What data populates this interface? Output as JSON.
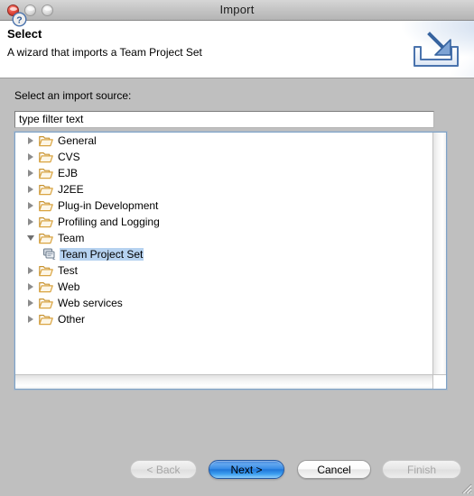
{
  "window": {
    "title": "Import",
    "traffic_lights": [
      {
        "name": "close-button",
        "color": "#e44b3e",
        "state": "active"
      },
      {
        "name": "minimize-button",
        "color": "#dcdcdc",
        "state": "disabled"
      },
      {
        "name": "zoom-button",
        "color": "#dcdcdc",
        "state": "disabled"
      }
    ]
  },
  "header": {
    "title": "Select",
    "subtitle": "A wizard that imports a Team Project Set",
    "icon": "import-wizard-icon"
  },
  "body": {
    "source_label": "Select an import source:",
    "filter": {
      "value": "type filter text",
      "placeholder": "type filter text"
    },
    "tree": [
      {
        "label": "General",
        "icon": "folder-icon",
        "expanded": false,
        "level": 0,
        "selected": false
      },
      {
        "label": "CVS",
        "icon": "folder-icon",
        "expanded": false,
        "level": 0,
        "selected": false
      },
      {
        "label": "EJB",
        "icon": "folder-icon",
        "expanded": false,
        "level": 0,
        "selected": false
      },
      {
        "label": "J2EE",
        "icon": "folder-icon",
        "expanded": false,
        "level": 0,
        "selected": false
      },
      {
        "label": "Plug-in Development",
        "icon": "folder-icon",
        "expanded": false,
        "level": 0,
        "selected": false
      },
      {
        "label": "Profiling and Logging",
        "icon": "folder-icon",
        "expanded": false,
        "level": 0,
        "selected": false
      },
      {
        "label": "Team",
        "icon": "folder-icon",
        "expanded": true,
        "level": 0,
        "selected": false
      },
      {
        "label": "Team Project Set",
        "icon": "project-set-icon",
        "expanded": null,
        "level": 1,
        "selected": true
      },
      {
        "label": "Test",
        "icon": "folder-icon",
        "expanded": false,
        "level": 0,
        "selected": false
      },
      {
        "label": "Web",
        "icon": "folder-icon",
        "expanded": false,
        "level": 0,
        "selected": false
      },
      {
        "label": "Web services",
        "icon": "folder-icon",
        "expanded": false,
        "level": 0,
        "selected": false
      },
      {
        "label": "Other",
        "icon": "folder-icon",
        "expanded": false,
        "level": 0,
        "selected": false
      }
    ],
    "scrollbars": {
      "vertical": "vertical-scrollbar",
      "horizontal": "horizontal-scrollbar"
    }
  },
  "footer": {
    "help_icon": "help-question-icon",
    "buttons": [
      {
        "label": "< Back",
        "state": "disabled"
      },
      {
        "label": "Next >",
        "state": "default"
      },
      {
        "label": "Cancel",
        "state": "normal"
      },
      {
        "label": "Finish",
        "state": "disabled"
      }
    ],
    "resize_grip": "resize-grip-icon"
  },
  "colors": {
    "selection": "#b6d2f0",
    "default_button": "#3b8fe8",
    "panel_border": "#7ea2c6",
    "window_bg": "#bfbfbf",
    "folder": "#d9a441"
  }
}
